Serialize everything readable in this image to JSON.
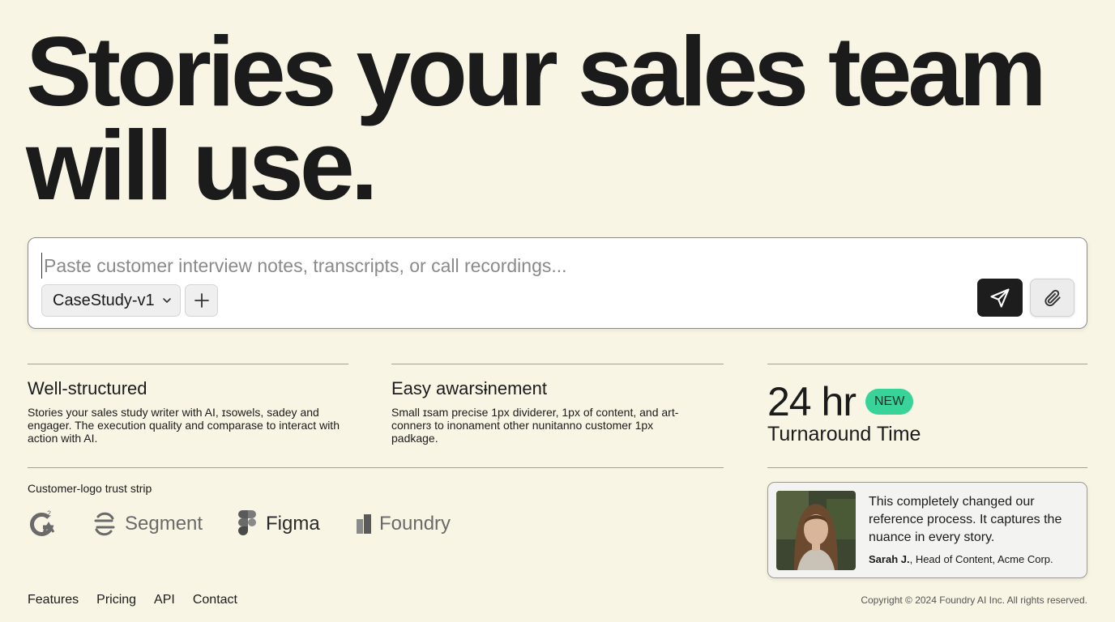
{
  "hero": {
    "line1": "Stories your sales team",
    "line2": "will use."
  },
  "composer": {
    "placeholder": "Paste customer interview notes, transcripts, or call recordings...",
    "value": "",
    "template_selected": "CaseStudy-v1",
    "icons": [
      "chevron-down-icon",
      "plus-icon",
      "send-icon",
      "paperclip-icon"
    ]
  },
  "features": [
    {
      "title": "Well-structured",
      "body": "Stories your sales study writer with AI, ɪsowels, sadey and engager. The execution quality and comparase to interact with action with AI."
    },
    {
      "title": "Easy awarsɨnement",
      "body": "Small ɪsam precise 1px dividerer, 1px of content, and art-connerɜ to inonamenṫ other nunitanno customer 1px padkage."
    }
  ],
  "stat": {
    "value": "24 hr",
    "badge": "NEW",
    "label": "Turnaround Time",
    "badge_color": "#37d398"
  },
  "trust": {
    "label": "Customer-logo trust strip",
    "logos": [
      "G2",
      "Segment",
      "Figma",
      "Foundry"
    ]
  },
  "testimonial": {
    "quote": "This completely changed our reference process. It captures the nuance in every story.",
    "author": "Sarah J.",
    "role": ", Head of Content, Acme Corp."
  },
  "footer": {
    "links": [
      "Features",
      "Pricing",
      "API",
      "Contact"
    ],
    "copyright": "Copyright © 2024 Foundry AI Inc. All rights reserved."
  }
}
